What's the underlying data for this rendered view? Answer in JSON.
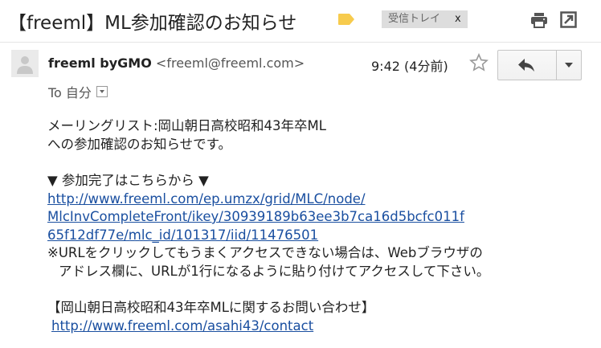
{
  "header": {
    "subject": "【freeml】ML参加確認のお知らせ",
    "label_chip": "受信トレイ",
    "label_remove": "x",
    "icons": [
      "label-tag-icon",
      "print-icon",
      "popout-icon"
    ],
    "label_tag_color": "#f7cb4d"
  },
  "message": {
    "sender_name": "freeml byGMO",
    "sender_email": "<freeml@freeml.com>",
    "time": "9:42 (4分前)",
    "to_label": "To 自分",
    "icons": [
      "avatar-icon",
      "star-icon",
      "reply-icon",
      "more-options-icon",
      "details-dropdown-icon"
    ]
  },
  "body": {
    "intro_line1": "メーリングリスト:岡山朝日高校昭和43年卒ML",
    "intro_line2": "への参加確認のお知らせです。",
    "complete_heading": "▼ 参加完了はこちらから ▼",
    "complete_link_line1": "http://www.freeml.com/ep.umzx/grid/MLC/node/",
    "complete_link_line2": "MlcInvCompleteFront/ikey/30939189b63ee3b7ca16d5bcfc011f",
    "complete_link_line3": "65f12df77e/mlc_id/101317/iid/11476501",
    "note_line1": "※URLをクリックしてもうまくアクセスできない場合は、Webブラウザの",
    "note_line2": "アドレス欄に、URLが1行になるように貼り付けてアクセスして下さい。",
    "contact_heading": "【岡山朝日高校昭和43年卒MLに関するお問い合わせ】",
    "contact_link": "http://www.freeml.com/asahi43/contact",
    "link_color": "#1a4fa0"
  }
}
